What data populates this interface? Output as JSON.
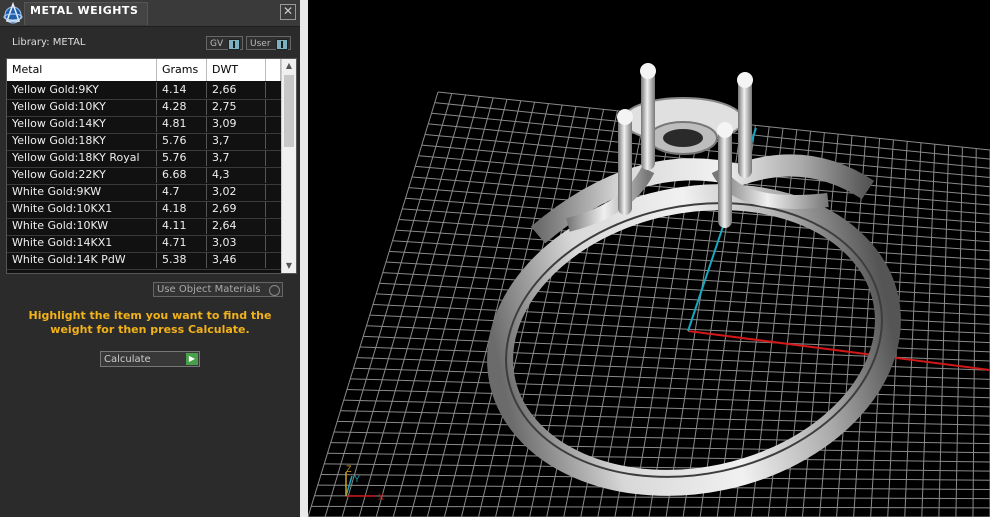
{
  "panel": {
    "title": "METAL WEIGHTS",
    "close_glyph": "✕",
    "library_label": "Library: METAL",
    "toggle_gv": "GV",
    "toggle_user": "User",
    "columns": [
      "Metal",
      "Grams",
      "DWT"
    ],
    "rows": [
      {
        "metal": "Yellow Gold:9KY",
        "grams": "4.14",
        "dwt": "2,66"
      },
      {
        "metal": "Yellow Gold:10KY",
        "grams": "4.28",
        "dwt": "2,75"
      },
      {
        "metal": "Yellow Gold:14KY",
        "grams": "4.81",
        "dwt": "3,09"
      },
      {
        "metal": "Yellow Gold:18KY",
        "grams": "5.76",
        "dwt": "3,7"
      },
      {
        "metal": "Yellow Gold:18KY Royal",
        "grams": "5.76",
        "dwt": "3,7"
      },
      {
        "metal": "Yellow Gold:22KY",
        "grams": "6.68",
        "dwt": "4,3"
      },
      {
        "metal": "White Gold:9KW",
        "grams": "4.7",
        "dwt": "3,02"
      },
      {
        "metal": "White Gold:10KX1",
        "grams": "4.18",
        "dwt": "2,69"
      },
      {
        "metal": "White Gold:10KW",
        "grams": "4.11",
        "dwt": "2,64"
      },
      {
        "metal": "White Gold:14KX1",
        "grams": "4.71",
        "dwt": "3,03"
      },
      {
        "metal": "White Gold:14K PdW",
        "grams": "5.38",
        "dwt": "3,46"
      }
    ],
    "use_object_materials": "Use Object Materials",
    "hint": "Highlight the item you want to find the weight for then press Calculate.",
    "calculate_label": "Calculate",
    "calculate_glyph": "▶"
  },
  "viewport": {
    "axis_x": "X",
    "axis_y": "Y",
    "axis_z": "Z",
    "colors": {
      "grid": "#8a8a8a",
      "x_axis": "#d01818",
      "y_axis": "#19a7c0",
      "ring": "#c8c8c8"
    }
  }
}
